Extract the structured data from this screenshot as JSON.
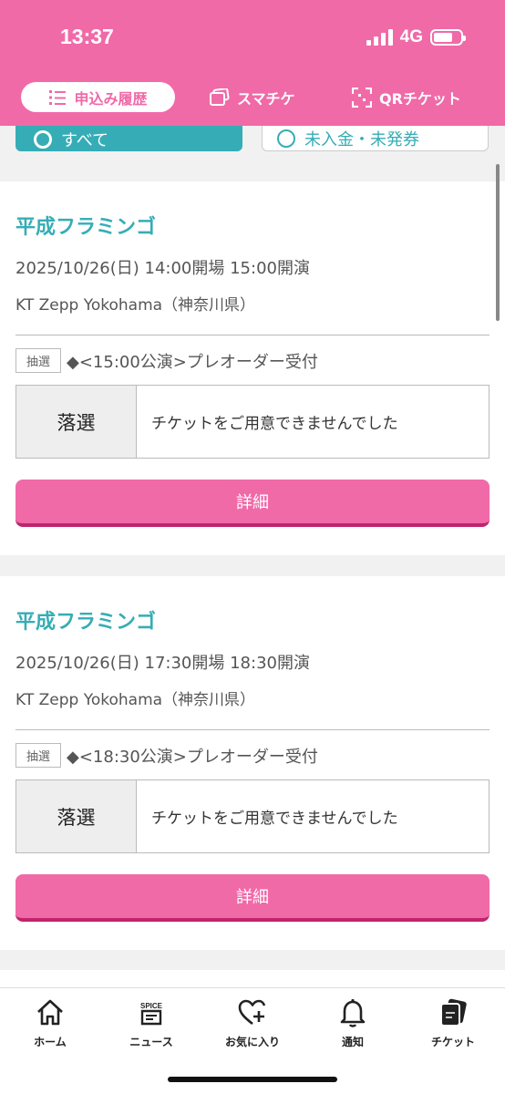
{
  "status_bar": {
    "time": "13:37",
    "network": "4G"
  },
  "tabs": [
    {
      "label": "申込み履歴",
      "icon": "list-icon",
      "active": true
    },
    {
      "label": "スマチケ",
      "icon": "smart-ticket-icon",
      "active": false
    },
    {
      "label": "QRチケット",
      "icon": "qr-icon",
      "active": false
    }
  ],
  "filters": [
    {
      "label": "すべて",
      "selected": true
    },
    {
      "label": "未入金・未発券",
      "selected": false
    }
  ],
  "cards": [
    {
      "title": "平成フラミンゴ",
      "datetime": "2025/10/26(日) 14:00開場 15:00開演",
      "venue": "KT Zepp Yokohama（神奈川県）",
      "badge": "抽選",
      "order": "◆<15:00公演>プレオーダー受付",
      "result_label": "落選",
      "result_text": "チケットをご用意できませんでした",
      "detail_label": "詳細"
    },
    {
      "title": "平成フラミンゴ",
      "datetime": "2025/10/26(日) 17:30開場 18:30開演",
      "venue": "KT Zepp Yokohama（神奈川県）",
      "badge": "抽選",
      "order": "◆<18:30公演>プレオーダー受付",
      "result_label": "落選",
      "result_text": "チケットをご用意できませんでした",
      "detail_label": "詳細"
    }
  ],
  "bottom_nav": [
    {
      "label": "ホーム",
      "icon": "home-icon"
    },
    {
      "label": "ニュース",
      "icon": "spice-news-icon",
      "icon_text": "SPICE"
    },
    {
      "label": "お気に入り",
      "icon": "heart-plus-icon"
    },
    {
      "label": "通知",
      "icon": "bell-icon"
    },
    {
      "label": "チケット",
      "icon": "ticket-icon"
    }
  ],
  "colors": {
    "brand_pink": "#f06aa8",
    "accent_teal": "#36adb6",
    "button_shadow": "#c0246c"
  }
}
